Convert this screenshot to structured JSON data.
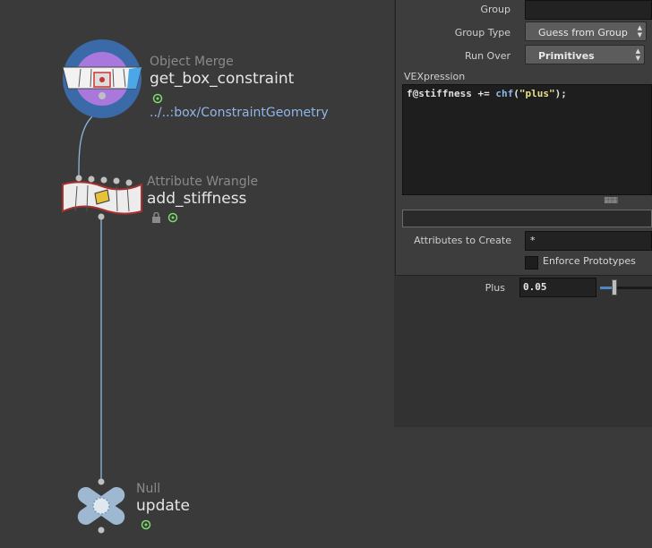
{
  "network": {
    "nodes": [
      {
        "type": "Object Merge",
        "name": "get_box_constraint",
        "path": "../..:box/ConstraintGeometry"
      },
      {
        "type": "Attribute Wrangle",
        "name": "add_stiffness"
      },
      {
        "type": "Null",
        "name": "update"
      }
    ]
  },
  "params": {
    "group_label": "Group",
    "group_value": "",
    "group_type_label": "Group Type",
    "group_type_value": "Guess from Group",
    "run_over_label": "Run Over",
    "run_over_value": "Primitives",
    "vexpression_label": "VEXpression",
    "code": {
      "part1": "f@stiffness += ",
      "fn": "chf",
      "part2": "(",
      "str": "\"plus\"",
      "part3": ");"
    },
    "attributes_label": "Attributes to Create",
    "attributes_value": "*",
    "enforce_label": "Enforce Prototypes",
    "plus_label": "Plus",
    "plus_value": "0.05",
    "plus_fraction": 0.05
  },
  "colors": {
    "object_merge": "#8f5fcf",
    "wire": "#8fb7d9",
    "flag_green": "#7bdc6a"
  }
}
